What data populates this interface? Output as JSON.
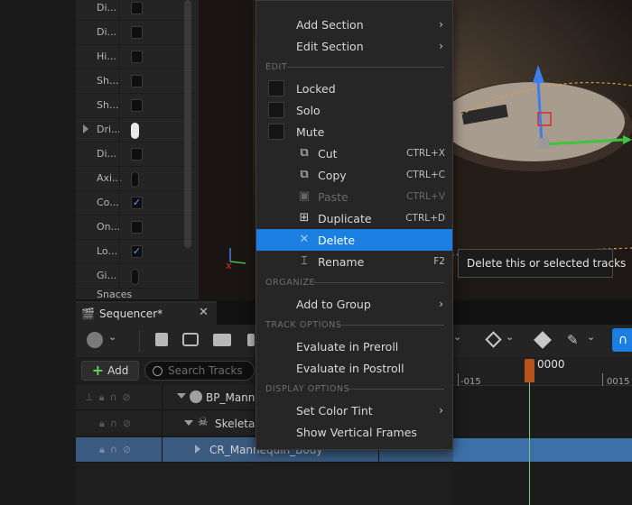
{
  "details_panel": {
    "rows": [
      {
        "label": "Di...",
        "control": "check",
        "checked": false
      },
      {
        "label": "Di...",
        "control": "check",
        "checked": false
      },
      {
        "label": "Hi...",
        "control": "check",
        "checked": false
      },
      {
        "label": "Sh...",
        "control": "check",
        "checked": false
      },
      {
        "label": "Sh...",
        "control": "check",
        "checked": false
      },
      {
        "label": "Dri...",
        "control": "pill-light",
        "expandable": true
      },
      {
        "label": "Di...",
        "control": "check",
        "checked": false
      },
      {
        "label": "Axi...",
        "control": "pill"
      },
      {
        "label": "Co...",
        "control": "check",
        "checked": true
      },
      {
        "label": "On...",
        "control": "check",
        "checked": false
      },
      {
        "label": "Lo...",
        "control": "check",
        "checked": true
      },
      {
        "label": "Gi...",
        "control": "pill"
      }
    ],
    "footer_label": "Snaces"
  },
  "sequencer": {
    "tab_title": "Sequencer*",
    "add_label": "Add",
    "search_placeholder": "Search Tracks",
    "tracks": [
      {
        "name": "BP_Manny",
        "indent": 0
      },
      {
        "name": "SkeletalM",
        "indent": 1
      },
      {
        "name": "CR_Mannequin_Body",
        "indent": 2
      }
    ],
    "timeline": {
      "playhead_label": "0000",
      "tick_left": "-015",
      "tick_right": "0015"
    }
  },
  "context_menu": {
    "items_top": [
      {
        "label": "Add Section",
        "submenu": true
      },
      {
        "label": "Edit Section",
        "submenu": true
      }
    ],
    "edit_header": "EDIT",
    "toggles": [
      {
        "label": "Locked"
      },
      {
        "label": "Solo"
      },
      {
        "label": "Mute"
      }
    ],
    "actions": [
      {
        "label": "Cut",
        "shortcut": "CTRL+X",
        "icon": "cut-icon",
        "disabled": false
      },
      {
        "label": "Copy",
        "shortcut": "CTRL+C",
        "icon": "copy-icon",
        "disabled": false
      },
      {
        "label": "Paste",
        "shortcut": "CTRL+V",
        "icon": "paste-icon",
        "disabled": true
      },
      {
        "label": "Duplicate",
        "shortcut": "CTRL+D",
        "icon": "duplicate-icon",
        "disabled": false
      },
      {
        "label": "Delete",
        "shortcut": "",
        "icon": "delete-x-icon",
        "disabled": false,
        "highlighted": true
      },
      {
        "label": "Rename",
        "shortcut": "F2",
        "icon": "rename-icon",
        "disabled": false
      }
    ],
    "organize_header": "ORGANIZE",
    "add_to_group": "Add to Group",
    "track_options_header": "TRACK OPTIONS",
    "evaluate_preroll": "Evaluate in Preroll",
    "evaluate_postroll": "Evaluate in Postroll",
    "display_options_header": "DISPLAY OPTIONS",
    "set_color_tint": "Set Color Tint",
    "show_vertical_frames": "Show Vertical Frames"
  },
  "tooltip": "Delete this or selected tracks",
  "colors": {
    "highlight": "#1a7fe0",
    "section_bar": "#3d6fa8",
    "playhead": "#b8531f",
    "playhead_line": "#6fd06f"
  }
}
